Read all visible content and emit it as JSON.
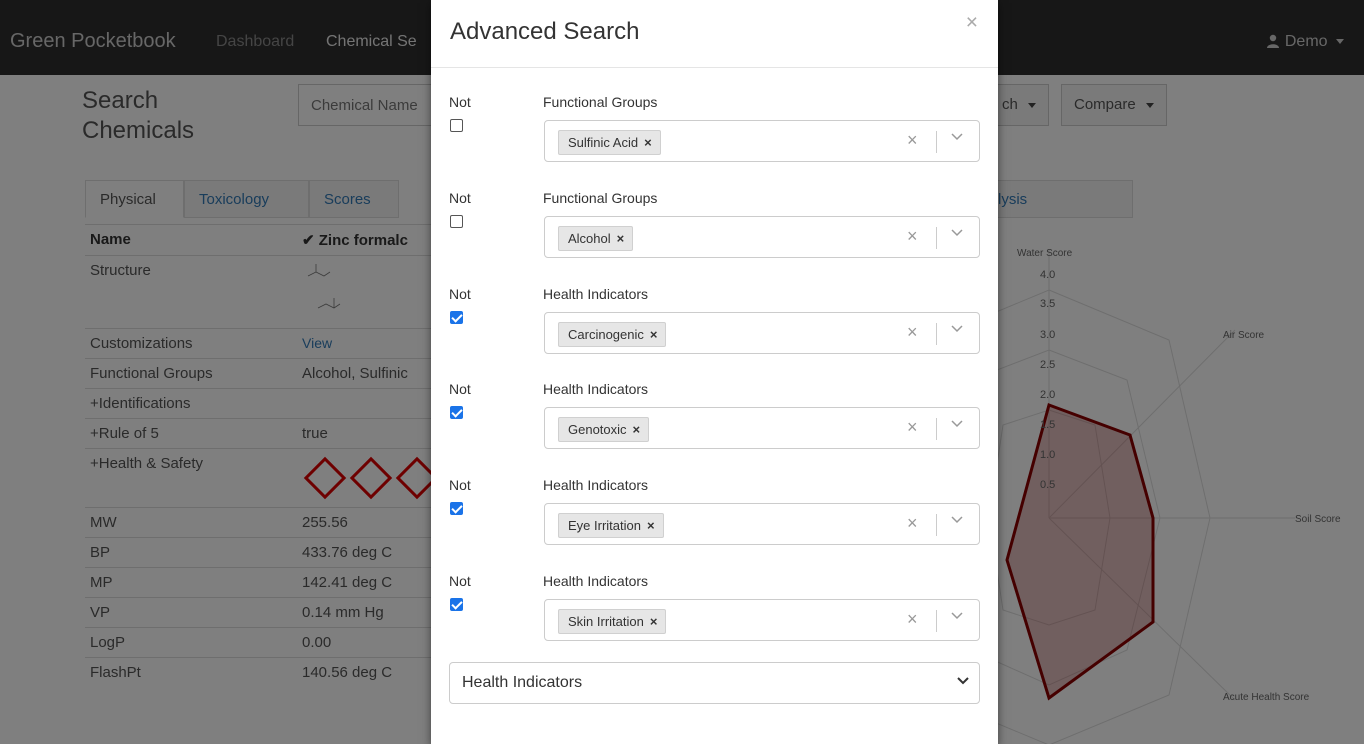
{
  "navbar": {
    "brand": "Green Pocketbook",
    "links": [
      "Dashboard",
      "Chemical Se"
    ],
    "user": "Demo"
  },
  "page": {
    "title": "Search Chemicals",
    "search_select": "Chemical Name",
    "buttons": [
      "ch",
      "Compare"
    ]
  },
  "tabs": [
    "Physical",
    "Toxicology",
    "Scores",
    "lysis"
  ],
  "table": {
    "header": {
      "key": "Name",
      "value": "Zinc formalc"
    },
    "rows": [
      {
        "key": "Structure",
        "value": ""
      },
      {
        "key": "Customizations",
        "value": "View"
      },
      {
        "key": "Functional Groups",
        "value": "Alcohol, Sulfinic"
      },
      {
        "key": "+Identifications",
        "value": ""
      },
      {
        "key": "+Rule of 5",
        "value": "true"
      },
      {
        "key": "+Health & Safety",
        "value": ""
      },
      {
        "key": "MW",
        "value": "255.56"
      },
      {
        "key": "BP",
        "value": "433.76 deg C"
      },
      {
        "key": "MP",
        "value": "142.41 deg C"
      },
      {
        "key": "VP",
        "value": "0.14 mm Hg"
      },
      {
        "key": "LogP",
        "value": "0.00"
      },
      {
        "key": "FlashPt",
        "value": "140.56 deg C"
      }
    ]
  },
  "radar": {
    "axis_labels": [
      "Water Score",
      "Air Score",
      "Soil Score",
      "Acute Health Score"
    ],
    "ticks": [
      "4.0",
      "3.5",
      "3.0",
      "2.5",
      "2.0",
      "1.5",
      "1.0",
      "0.5"
    ],
    "colors": {
      "line": "#8b0000",
      "fill": "rgba(139,0,0,0.25)"
    }
  },
  "modal": {
    "title": "Advanced Search",
    "close": "×",
    "not_label": "Not",
    "criteria": [
      {
        "field": "Functional Groups",
        "tag": "Sulfinic Acid",
        "not": false
      },
      {
        "field": "Functional Groups",
        "tag": "Alcohol",
        "not": false
      },
      {
        "field": "Health Indicators",
        "tag": "Carcinogenic",
        "not": true
      },
      {
        "field": "Health Indicators",
        "tag": "Genotoxic",
        "not": true
      },
      {
        "field": "Health Indicators",
        "tag": "Eye Irritation",
        "not": true
      },
      {
        "field": "Health Indicators",
        "tag": "Skin Irritation",
        "not": true
      }
    ],
    "add_select": "Health Indicators",
    "tag_remove": "×",
    "clear": "×"
  }
}
